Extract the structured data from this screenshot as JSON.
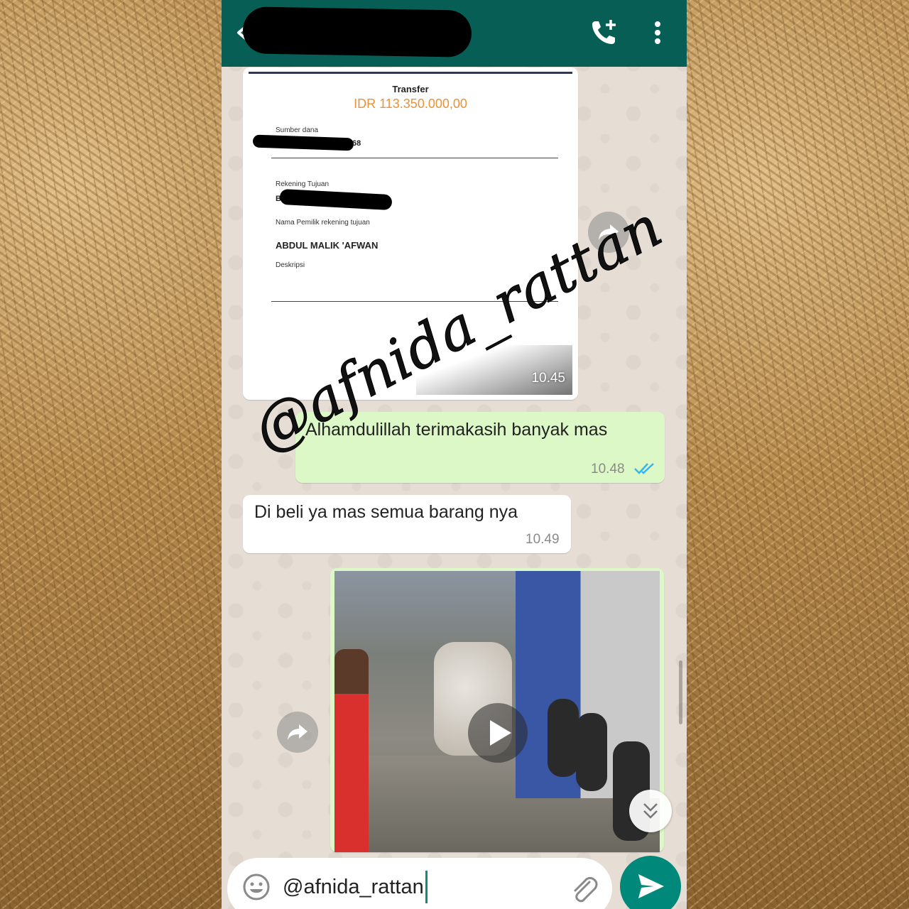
{
  "header": {
    "back_icon": "arrow-back-icon",
    "call_icon": "add-call-icon",
    "menu_icon": "more-vert-icon",
    "color": "#075e54"
  },
  "receipt": {
    "title": "Transfer",
    "amount": "IDR 113.350.000,00",
    "source_label": "Sumber dana",
    "source_suffix": "68",
    "dest_label": "Rekening Tujuan",
    "dest_prefix": "B",
    "owner_label": "Nama Pemilik rekening tujuan",
    "owner_name": "ABDUL MALIK 'AFWAN",
    "desc_label": "Deskripsi",
    "time": "10.45"
  },
  "messages": {
    "outgoing_1": {
      "text": "Alhamdulillah terimakasih banyak mas",
      "time": "10.48"
    },
    "incoming_1": {
      "text": "Di beli ya mas semua  barang nya",
      "time": "10.49"
    }
  },
  "video": {
    "play_icon": "play-icon"
  },
  "composer": {
    "text": "@afnida_rattan",
    "emoji_icon": "emoji-icon",
    "attach_icon": "paperclip-icon",
    "send_icon": "send-icon"
  },
  "watermark": "@afnida_rattan",
  "colors": {
    "outgoing_bubble": "#dcf8c6",
    "incoming_bubble": "#ffffff",
    "accent": "#00897b",
    "amount": "#e8923a",
    "read_ticks": "#34b7f1"
  }
}
